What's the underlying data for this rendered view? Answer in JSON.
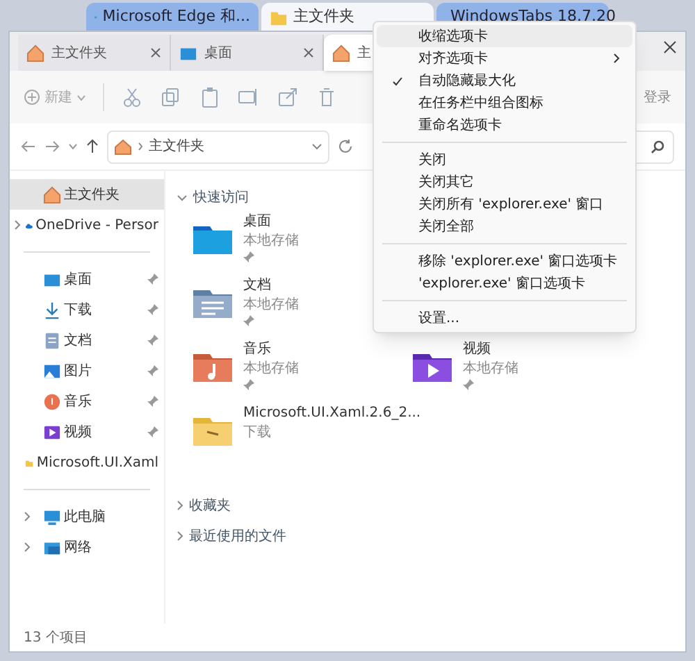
{
  "browser_tabs": [
    {
      "label": "Microsoft Edge 和...",
      "selected": false
    },
    {
      "label": "主文件夹",
      "selected": true
    },
    {
      "label": "WindowsTabs 18.7.20",
      "selected": false
    }
  ],
  "window_tabs": [
    {
      "label": "主文件夹",
      "selected": false
    },
    {
      "label": "桌面",
      "selected": false
    },
    {
      "label": "主",
      "selected": true
    }
  ],
  "toolbar": {
    "new_label": "新建",
    "login_label": "登录"
  },
  "address": {
    "path": "主文件夹"
  },
  "sidebar": {
    "items": [
      {
        "label": "主文件夹",
        "selected": true,
        "pinned": false,
        "expandable": false
      },
      {
        "label": "OneDrive - Persor",
        "selected": false,
        "pinned": false,
        "expandable": true
      },
      {
        "kind": "divider"
      },
      {
        "label": "桌面",
        "selected": false,
        "pinned": true,
        "expandable": false
      },
      {
        "label": "下载",
        "selected": false,
        "pinned": true,
        "expandable": false
      },
      {
        "label": "文档",
        "selected": false,
        "pinned": true,
        "expandable": false
      },
      {
        "label": "图片",
        "selected": false,
        "pinned": true,
        "expandable": false
      },
      {
        "label": "音乐",
        "selected": false,
        "pinned": true,
        "expandable": false
      },
      {
        "label": "视频",
        "selected": false,
        "pinned": true,
        "expandable": false
      },
      {
        "label": "Microsoft.UI.Xaml",
        "selected": false,
        "pinned": false,
        "expandable": false
      },
      {
        "kind": "divider"
      },
      {
        "label": "此电脑",
        "selected": false,
        "pinned": false,
        "expandable": true
      },
      {
        "label": "网络",
        "selected": false,
        "pinned": false,
        "expandable": true
      }
    ]
  },
  "content": {
    "quick_access": {
      "title": "快速访问",
      "expanded": true,
      "items": [
        {
          "name": "桌面",
          "location": "本地存储",
          "pinned": true
        },
        {
          "name": "文档",
          "location": "本地存储",
          "pinned": true
        },
        {
          "name": "音乐",
          "location": "本地存储",
          "pinned": true
        },
        {
          "name": "视频",
          "location": "本地存储",
          "pinned": true
        },
        {
          "name": "Microsoft.UI.Xaml.2.6_2...",
          "location": "下载",
          "pinned": false
        }
      ]
    },
    "sections": [
      {
        "title": "收藏夹",
        "expanded": false
      },
      {
        "title": "最近使用的文件",
        "expanded": false
      }
    ]
  },
  "status_bar": {
    "count": "13 个项目"
  },
  "context_menu": {
    "items": [
      {
        "kind": "item",
        "label": "收缩选项卡",
        "selected": true,
        "checked": false,
        "submenu": false
      },
      {
        "kind": "item",
        "label": "对齐选项卡",
        "selected": false,
        "checked": false,
        "submenu": true
      },
      {
        "kind": "item",
        "label": "自动隐藏最大化",
        "selected": false,
        "checked": true,
        "submenu": false
      },
      {
        "kind": "item",
        "label": "在任务栏中组合图标",
        "selected": false,
        "checked": false,
        "submenu": false
      },
      {
        "kind": "item",
        "label": "重命名选项卡",
        "selected": false,
        "checked": false,
        "submenu": false
      },
      {
        "kind": "separator"
      },
      {
        "kind": "item",
        "label": "关闭",
        "selected": false,
        "checked": false,
        "submenu": false
      },
      {
        "kind": "item",
        "label": "关闭其它",
        "selected": false,
        "checked": false,
        "submenu": false
      },
      {
        "kind": "item",
        "label": "关闭所有 'explorer.exe' 窗口",
        "selected": false,
        "checked": false,
        "submenu": false
      },
      {
        "kind": "item",
        "label": "关闭全部",
        "selected": false,
        "checked": false,
        "submenu": false
      },
      {
        "kind": "separator"
      },
      {
        "kind": "item",
        "label": "移除 'explorer.exe' 窗口选项卡",
        "selected": false,
        "checked": false,
        "submenu": false
      },
      {
        "kind": "item",
        "label": "'explorer.exe' 窗口选项卡",
        "selected": false,
        "checked": false,
        "submenu": false
      },
      {
        "kind": "separator"
      },
      {
        "kind": "item",
        "label": "设置...",
        "selected": false,
        "checked": false,
        "submenu": false
      }
    ]
  }
}
